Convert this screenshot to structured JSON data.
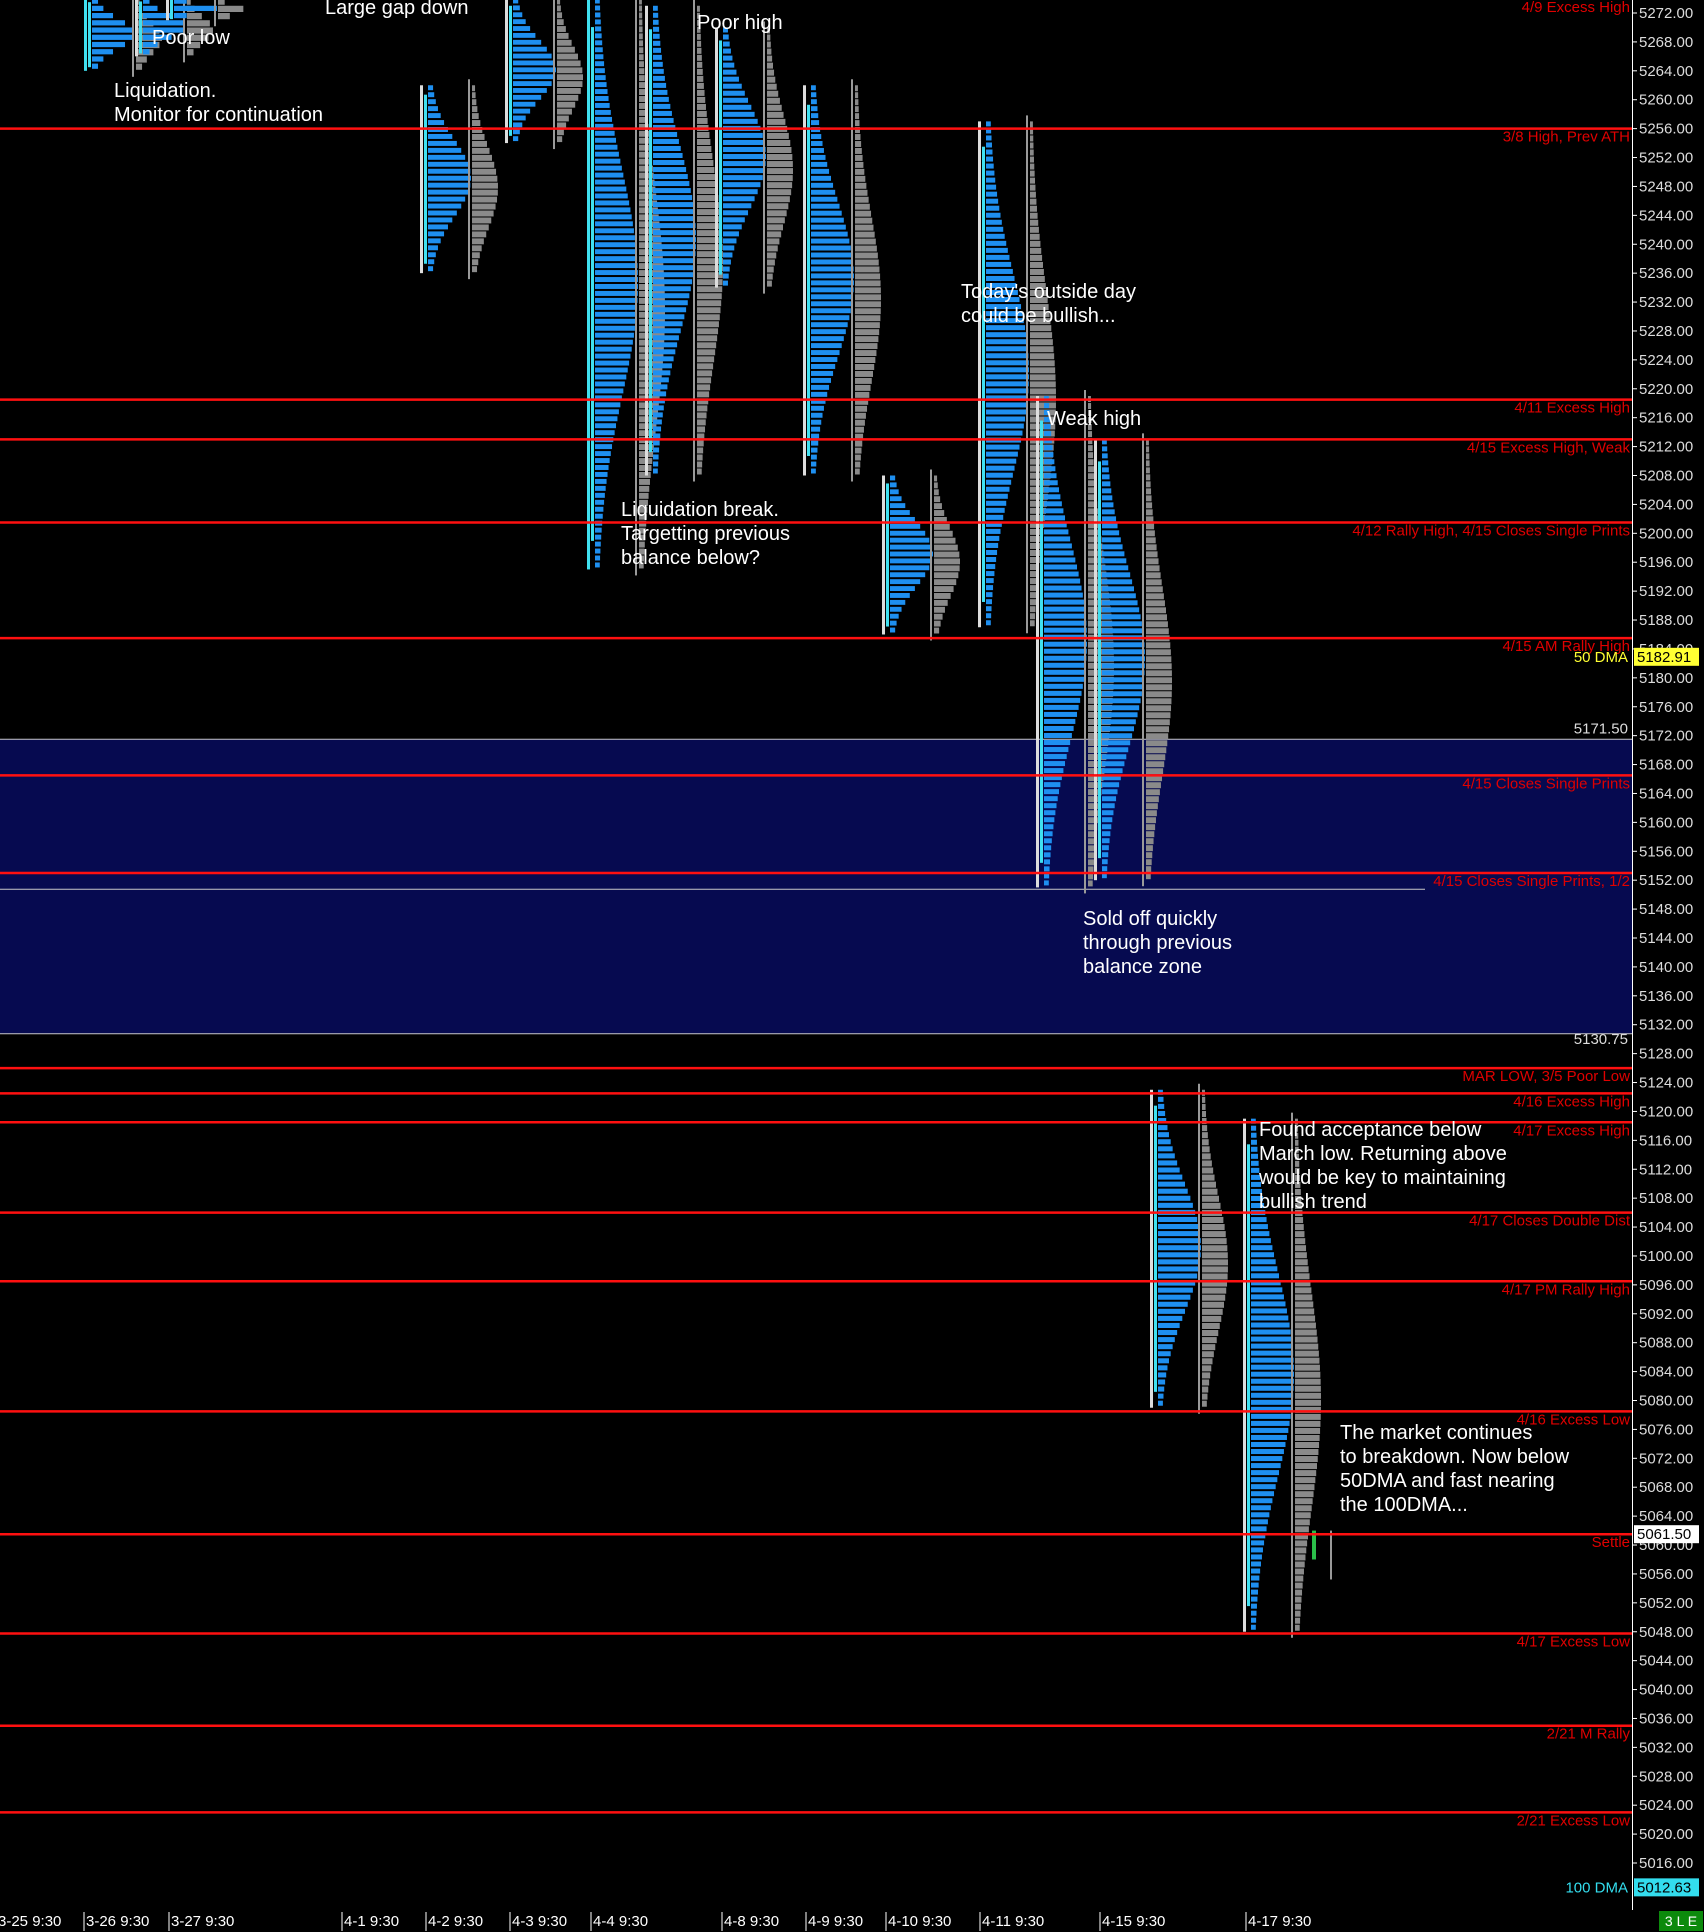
{
  "chart_data": {
    "type": "market-profile",
    "colors": {
      "background": "#000000",
      "level_line": "#ff1010",
      "level_label": "#e00000",
      "balance_zone": "#060a50",
      "profile_blue": "#1e8ff0",
      "profile_cyan": "#40e0f0",
      "profile_gray": "#bdbdbd",
      "volume_gray": "#8a8a8a",
      "dma50": "#ffff33",
      "dma100": "#33ddee",
      "settle_tag": "#ffffff"
    },
    "y_axis": {
      "ylim": [
        5010.5,
        5274
      ],
      "ticks": [
        5272,
        5268,
        5264,
        5260,
        5256,
        5252,
        5248,
        5244,
        5240,
        5236,
        5232,
        5228,
        5224,
        5220,
        5216,
        5212,
        5208,
        5204,
        5200,
        5196,
        5192,
        5188,
        5184,
        5180,
        5176,
        5172,
        5168,
        5164,
        5160,
        5156,
        5152,
        5148,
        5144,
        5140,
        5136,
        5132,
        5128,
        5124,
        5120,
        5116,
        5112,
        5108,
        5104,
        5100,
        5096,
        5092,
        5088,
        5084,
        5080,
        5076,
        5072,
        5068,
        5064,
        5060,
        5056,
        5052,
        5048,
        5044,
        5040,
        5036,
        5032,
        5028,
        5024,
        5020,
        5016
      ],
      "tick_labels": [
        "5272.00",
        "5268.00",
        "5264.00",
        "5260.00",
        "5256.00",
        "5252.00",
        "5248.00",
        "5244.00",
        "5240.00",
        "5236.00",
        "5232.00",
        "5228.00",
        "5224.00",
        "5220.00",
        "5216.00",
        "5212.00",
        "5208.00",
        "5204.00",
        "5200.00",
        "5196.00",
        "5192.00",
        "5188.00",
        "5184.00",
        "5180.00",
        "5176.00",
        "5172.00",
        "5168.00",
        "5164.00",
        "5160.00",
        "5156.00",
        "5152.00",
        "5148.00",
        "5144.00",
        "5140.00",
        "5136.00",
        "5132.00",
        "5128.00",
        "5124.00",
        "5120.00",
        "5116.00",
        "5112.00",
        "5108.00",
        "5104.00",
        "5100.00",
        "5096.00",
        "5092.00",
        "5088.00",
        "5084.00",
        "5080.00",
        "5076.00",
        "5072.00",
        "5068.00",
        "5064.00",
        "5060.00",
        "5056.00",
        "5052.00",
        "5048.00",
        "5044.00",
        "5040.00",
        "5036.00",
        "5032.00",
        "5028.00",
        "5024.00",
        "5020.00",
        "5016.00"
      ]
    },
    "x_axis": {
      "sessions": [
        "3-25 9:30",
        "3-26 9:30",
        "3-27 9:30",
        "4-1 9:30",
        "4-2 9:30",
        "4-3 9:30",
        "4-4 9:30",
        "4-8 9:30",
        "4-9 9:30",
        "4-10 9:30",
        "4-11 9:30",
        "4-15 9:30",
        "4-17 9:30"
      ]
    },
    "levels": [
      {
        "price": 5256.0,
        "label": "3/8 High, Prev ATH"
      },
      {
        "price": 5218.5,
        "label": "4/11 Excess High"
      },
      {
        "price": 5213.0,
        "label": "4/15 Excess High, Weak"
      },
      {
        "price": 5201.5,
        "label": "4/12 Rally High, 4/15 Closes Single Prints"
      },
      {
        "price": 5185.5,
        "label": "4/15 AM Rally High"
      },
      {
        "price": 5166.5,
        "label": "4/15 Closes Single Prints"
      },
      {
        "price": 5153.0,
        "label": "4/15 Closes Single Prints, 1/2"
      },
      {
        "price": 5126.0,
        "label": "MAR LOW, 3/5 Poor Low"
      },
      {
        "price": 5122.5,
        "label": "4/16 Excess High"
      },
      {
        "price": 5118.5,
        "label": "4/17 Excess High"
      },
      {
        "price": 5106.0,
        "label": "4/17 Closes Double Dist"
      },
      {
        "price": 5096.5,
        "label": "4/17 PM Rally High"
      },
      {
        "price": 5078.5,
        "label": "4/16 Excess Low"
      },
      {
        "price": 5061.5,
        "label": "Settle"
      },
      {
        "price": 5047.75,
        "label": "4/17 Excess Low"
      },
      {
        "price": 5035.0,
        "label": "2/21 M Rally"
      },
      {
        "price": 5023.0,
        "label": "2/21 Excess Low"
      }
    ],
    "top_label": "4/9 Excess High",
    "balance_zone": {
      "high": 5171.5,
      "low": 5130.75,
      "high_label": "5171.50",
      "low_label": "5130.75",
      "mid_line": 5150.75
    },
    "dma": [
      {
        "name": "50 DMA",
        "value": 5182.91,
        "value_label": "5182.91"
      },
      {
        "name": "100 DMA",
        "value": 5012.63,
        "value_label": "5012.63"
      }
    ],
    "last_price": {
      "value": 5061.5,
      "value_label": "5061.50"
    },
    "profiles": [
      {
        "high": 5274,
        "low": 5264
      },
      {
        "high": 5274,
        "low": 5266
      },
      {
        "high": 5274,
        "low": 5271
      },
      {
        "high": 5262,
        "low": 5236
      },
      {
        "high": 5274,
        "low": 5254
      },
      {
        "high": 5274,
        "low": 5195
      },
      {
        "high": 5273,
        "low": 5208
      },
      {
        "high": 5270,
        "low": 5234
      },
      {
        "high": 5262,
        "low": 5208
      },
      {
        "high": 5208,
        "low": 5186
      },
      {
        "high": 5257,
        "low": 5187
      },
      {
        "high": 5219,
        "low": 5151
      },
      {
        "high": 5213,
        "low": 5152
      },
      {
        "high": 5123,
        "low": 5079
      },
      {
        "high": 5119,
        "low": 5048
      },
      {
        "high": 5062,
        "low": 5058
      }
    ]
  },
  "annotations": {
    "poor_low": "Poor low",
    "large_gap": "Large gap down",
    "liquidation": "Liquidation.\nMonitor for continuation",
    "poor_high": "Poor high",
    "outside_day": "Today's outside day\ncould be bullish...",
    "weak_high": "Weak high",
    "liq_break": "Liquidation break.\nTargetting previous\nbalance below?",
    "sold_off": "Sold off quickly\nthrough previous\nbalance zone",
    "acceptance": "Found acceptance below\nMarch low. Returning above\nwould be key to maintaining\nbullish trend",
    "continues": "The market continues\nto breakdown. Now below\n50DMA and fast nearing\nthe 100DMA..."
  },
  "status": {
    "corner": "3 L E"
  }
}
